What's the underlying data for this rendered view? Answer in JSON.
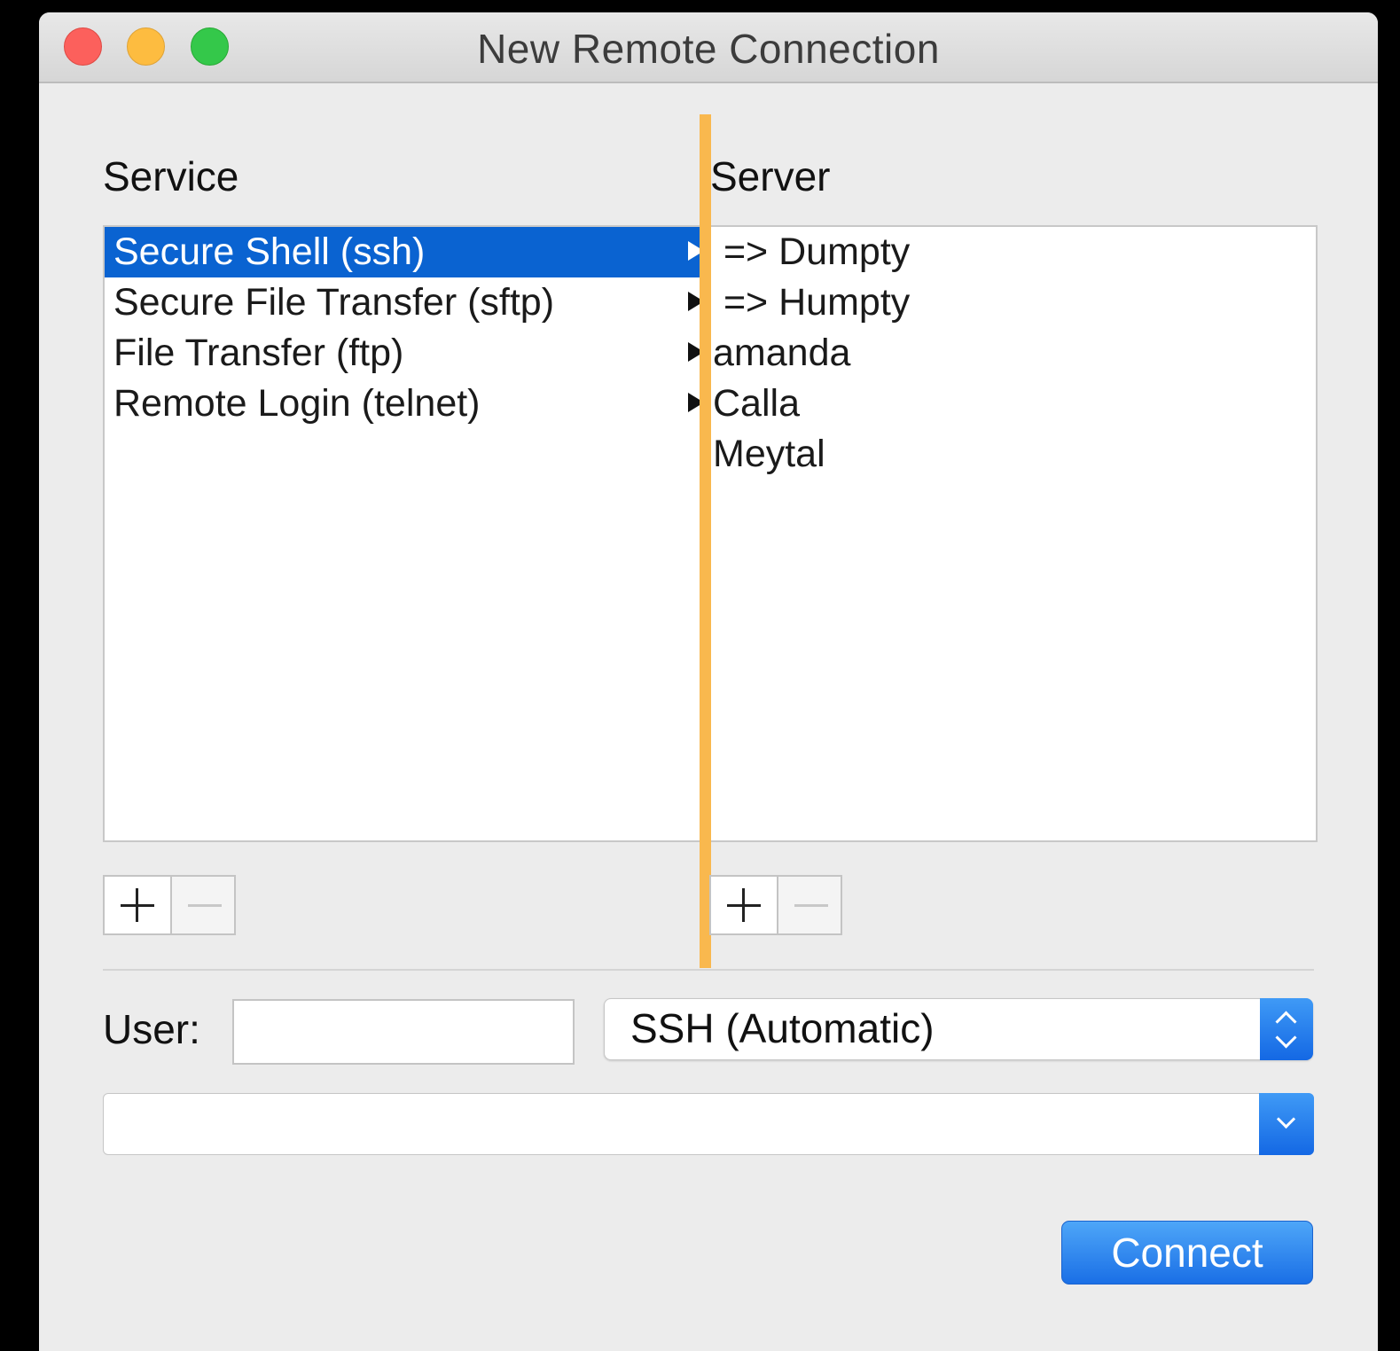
{
  "window": {
    "title": "New Remote Connection"
  },
  "service": {
    "label": "Service",
    "items": [
      {
        "label": "Secure Shell (ssh)",
        "selected": true
      },
      {
        "label": "Secure File Transfer (sftp)",
        "selected": false
      },
      {
        "label": "File Transfer (ftp)",
        "selected": false
      },
      {
        "label": "Remote Login (telnet)",
        "selected": false
      }
    ]
  },
  "server": {
    "label": "Server",
    "items": [
      {
        "label": " => Dumpty"
      },
      {
        "label": " => Humpty"
      },
      {
        "label": "amanda"
      },
      {
        "label": "Calla"
      },
      {
        "label": "Meytal"
      }
    ]
  },
  "user": {
    "label": "User:",
    "value": ""
  },
  "protocol_popup": {
    "value": "SSH (Automatic)"
  },
  "command_combo": {
    "value": ""
  },
  "connect_button": {
    "label": "Connect"
  },
  "colors": {
    "selection": "#0a63d1",
    "accent": "#1a6fe6",
    "divider_highlight": "#f9b84e"
  },
  "icons": {
    "add": "plus-icon",
    "remove": "minus-icon",
    "expand": "disclosure-arrow-icon",
    "popup": "up-down-chevron-icon",
    "combo": "chevron-down-icon"
  }
}
